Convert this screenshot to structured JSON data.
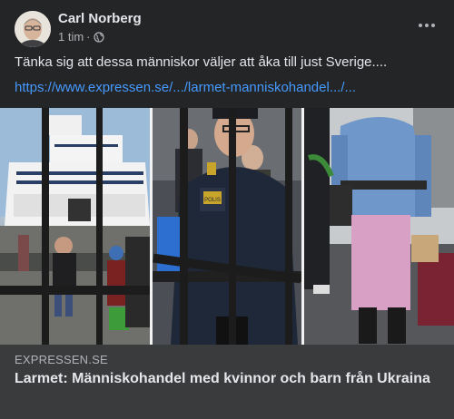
{
  "post": {
    "author": "Carl Norberg",
    "time": "1 tim",
    "separator": "·",
    "audience_icon": "globe-icon",
    "options_icon": "more-horizontal-icon",
    "text": "Tänka sig att dessa människor väljer att åka till just Sverige....",
    "link": "https://www.expressen.se/.../larmet-manniskohandel.../..."
  },
  "link_preview": {
    "domain": "EXPRESSEN.SE",
    "title": "Larmet: Människohandel med kvinnor och barn från Ukraina"
  },
  "photo": {
    "badge_text": "POLIS"
  },
  "colors": {
    "background": "#242526",
    "preview_background": "#3a3b3c",
    "link": "#4599ff",
    "primary_text": "#e4e6eb",
    "secondary_text": "#b0b3b8"
  }
}
